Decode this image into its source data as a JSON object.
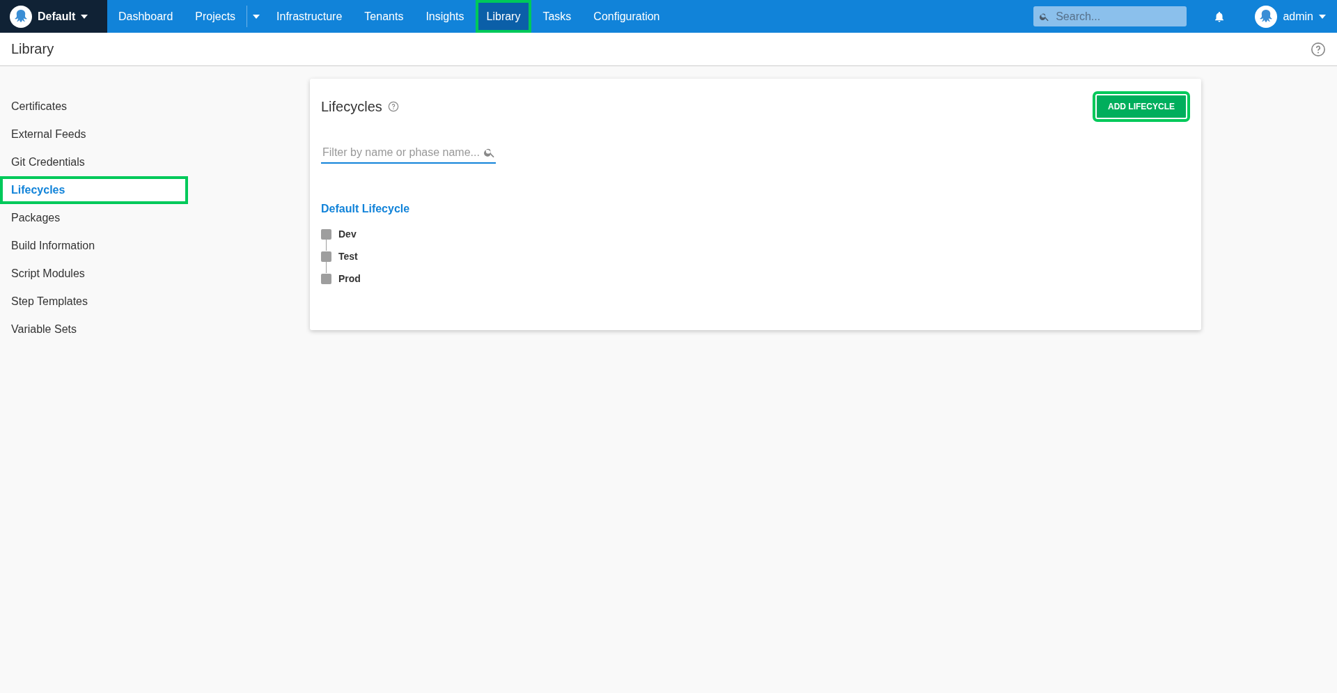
{
  "space": {
    "name": "Default"
  },
  "nav": [
    {
      "label": "Dashboard",
      "selected": false,
      "highlighted": false,
      "dropdown": false
    },
    {
      "label": "Projects",
      "selected": false,
      "highlighted": false,
      "dropdown": true
    },
    {
      "label": "Infrastructure",
      "selected": false,
      "highlighted": false,
      "dropdown": false
    },
    {
      "label": "Tenants",
      "selected": false,
      "highlighted": false,
      "dropdown": false
    },
    {
      "label": "Insights",
      "selected": false,
      "highlighted": false,
      "dropdown": false
    },
    {
      "label": "Library",
      "selected": true,
      "highlighted": true,
      "dropdown": false
    },
    {
      "label": "Tasks",
      "selected": false,
      "highlighted": false,
      "dropdown": false
    },
    {
      "label": "Configuration",
      "selected": false,
      "highlighted": false,
      "dropdown": false
    }
  ],
  "search": {
    "placeholder": "Search..."
  },
  "user": {
    "name": "admin"
  },
  "page_title": "Library",
  "sidebar": {
    "items": [
      {
        "label": "Certificates",
        "selected": false,
        "highlighted": false
      },
      {
        "label": "External Feeds",
        "selected": false,
        "highlighted": false
      },
      {
        "label": "Git Credentials",
        "selected": false,
        "highlighted": false
      },
      {
        "label": "Lifecycles",
        "selected": true,
        "highlighted": true
      },
      {
        "label": "Packages",
        "selected": false,
        "highlighted": false
      },
      {
        "label": "Build Information",
        "selected": false,
        "highlighted": false
      },
      {
        "label": "Script Modules",
        "selected": false,
        "highlighted": false
      },
      {
        "label": "Step Templates",
        "selected": false,
        "highlighted": false
      },
      {
        "label": "Variable Sets",
        "selected": false,
        "highlighted": false
      }
    ]
  },
  "card": {
    "title": "Lifecycles",
    "add_button": {
      "label": "ADD LIFECYCLE",
      "highlighted": true
    },
    "filter": {
      "placeholder": "Filter by name or phase name..."
    },
    "lifecycles": [
      {
        "name": "Default Lifecycle",
        "phases": [
          "Dev",
          "Test",
          "Prod"
        ]
      }
    ]
  }
}
